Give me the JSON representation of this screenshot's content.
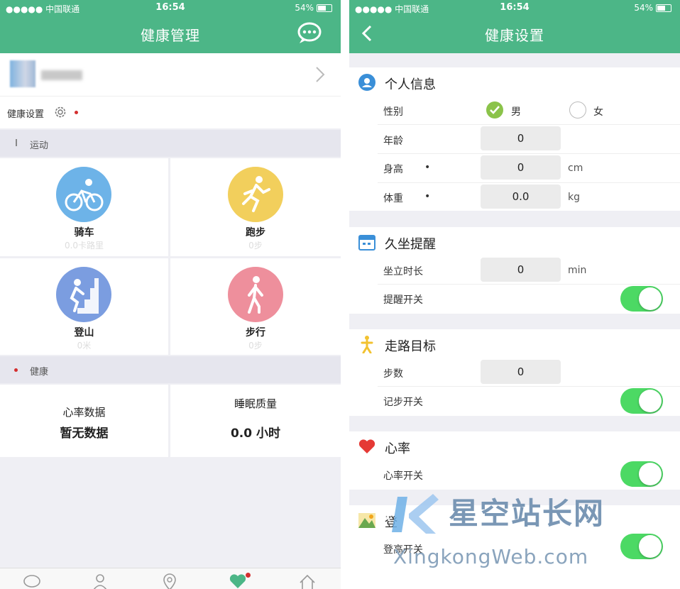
{
  "left": {
    "status": {
      "carrier": "●●●●● 中国联通",
      "time": "16:54",
      "battery": "54%"
    },
    "title": "健康管理",
    "health_settings_label": "健康设置",
    "sections": {
      "sport": "运动",
      "health": "健康"
    },
    "activities": [
      {
        "label": "骑车",
        "value": "0.0卡路里",
        "color": "#6db3e8",
        "icon": "bike-icon"
      },
      {
        "label": "跑步",
        "value": "0步",
        "color": "#f2cf5c",
        "icon": "run-icon"
      },
      {
        "label": "登山",
        "value": "0米",
        "color": "#7b9de0",
        "icon": "climb-icon"
      },
      {
        "label": "步行",
        "value": "0步",
        "color": "#ee8f9c",
        "icon": "walk-icon"
      }
    ],
    "health_cards": [
      {
        "title": "心率数据",
        "value": "暂无数据"
      },
      {
        "title": "睡眠质量",
        "value": "0.0 小时"
      }
    ]
  },
  "right": {
    "status": {
      "carrier": "●●●●● 中国联通",
      "time": "16:54",
      "battery": "54%"
    },
    "title": "健康设置",
    "personal": {
      "heading": "个人信息",
      "gender_label": "性别",
      "male": "男",
      "female": "女",
      "age_label": "年龄",
      "age_value": "0",
      "height_label": "身高",
      "height_value": "0",
      "height_unit": "cm",
      "weight_label": "体重",
      "weight_value": "0.0",
      "weight_unit": "kg",
      "asterisk": "•"
    },
    "sedentary": {
      "heading": "久坐提醒",
      "duration_label": "坐立时长",
      "duration_value": "0",
      "duration_unit": "min",
      "switch_label": "提醒开关"
    },
    "walking": {
      "heading": "走路目标",
      "steps_label": "步数",
      "steps_value": "0",
      "switch_label": "记步开关"
    },
    "heart": {
      "heading": "心率",
      "switch_label": "心率开关"
    },
    "climb": {
      "heading": "登",
      "switch_label": "登高开关"
    }
  },
  "watermark": {
    "cn": "星空站长网",
    "en": "XingkongWeb.com"
  },
  "colors": {
    "header": "#4cb687",
    "toggle_on": "#4cd964",
    "check": "#8bc34a"
  }
}
